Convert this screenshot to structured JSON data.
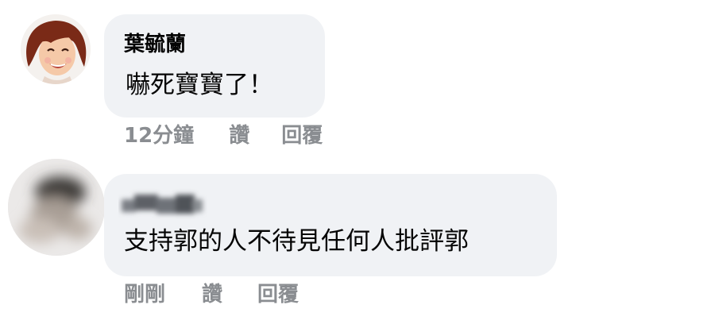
{
  "comments": [
    {
      "author": "葉毓蘭",
      "avatar": "cartoon-woman-avatar-icon",
      "text": "嚇死寶寶了！",
      "time": "12分鐘",
      "like_label": "讚",
      "reply_label": "回覆"
    },
    {
      "author": "",
      "avatar": "blurred-avatar",
      "text": "支持郭的人不待見任何人批評郭",
      "time": "剛剛",
      "like_label": "讚",
      "reply_label": "回覆"
    }
  ],
  "colors": {
    "bubble": "#f0f2f5",
    "text": "#050505",
    "meta": "#8a8d91"
  }
}
